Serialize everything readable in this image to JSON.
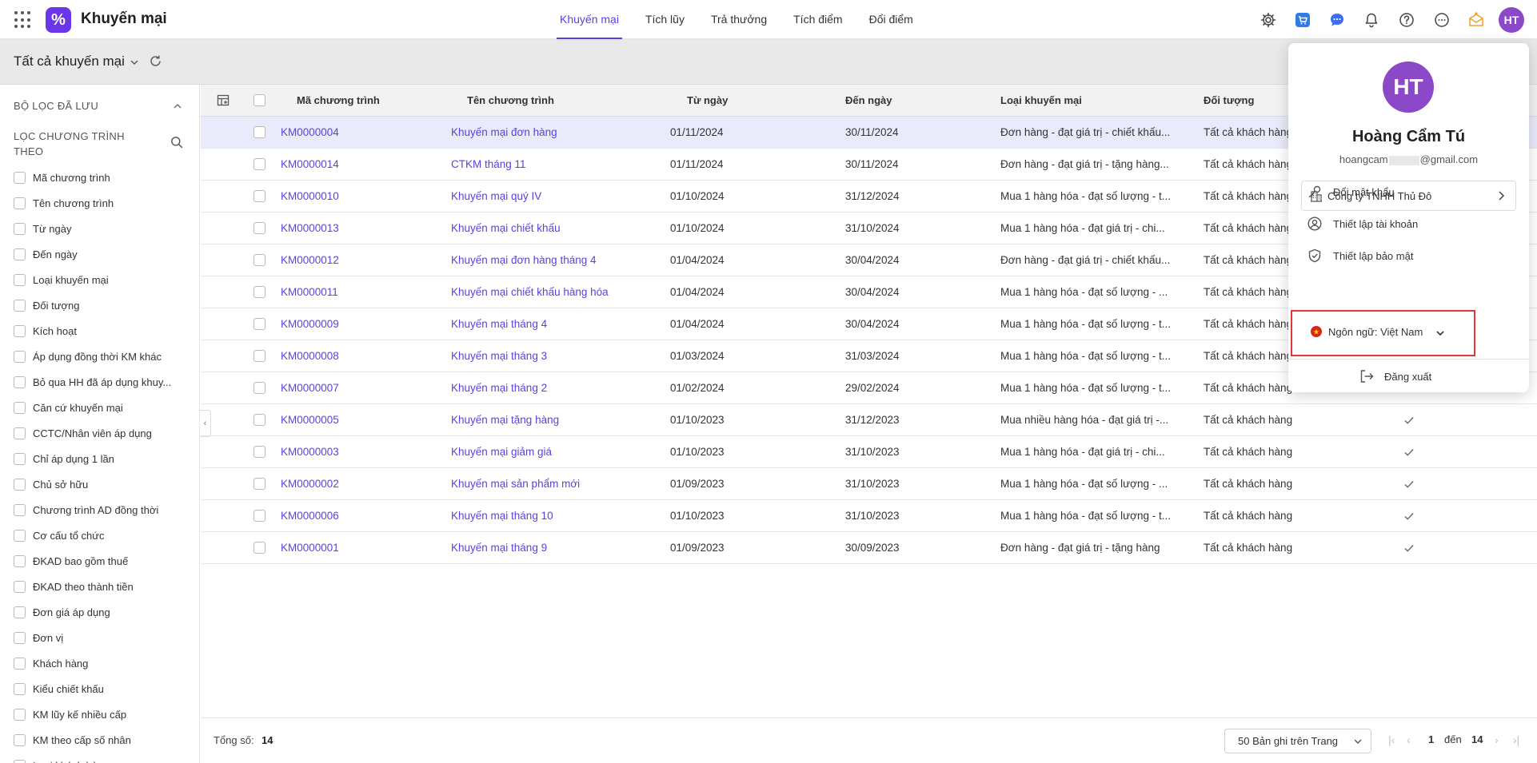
{
  "app": {
    "title": "Khuyến mại",
    "logo_glyph": "%"
  },
  "nav": {
    "items": [
      {
        "label": "Khuyến mại",
        "active": true
      },
      {
        "label": "Tích lũy",
        "active": false
      },
      {
        "label": "Trả thưởng",
        "active": false
      },
      {
        "label": "Tích điểm",
        "active": false
      },
      {
        "label": "Đổi điểm",
        "active": false
      }
    ]
  },
  "topbar": {
    "avatar_initials": "HT"
  },
  "subheader": {
    "view_label": "Tất cả khuyến mại"
  },
  "sidebar": {
    "saved_filters_label": "BỘ LỌC ĐÃ LƯU",
    "filter_by_label": "LỌC CHƯƠNG TRÌNH THEO",
    "filters": [
      "Mã chương trình",
      "Tên chương trình",
      "Từ ngày",
      "Đến ngày",
      "Loại khuyến mại",
      "Đối tượng",
      "Kích hoạt",
      "Áp dụng đồng thời KM khác",
      "Bỏ qua HH đã áp dụng khuy...",
      "Căn cứ khuyến mại",
      "CCTC/Nhân viên áp dụng",
      "Chỉ áp dụng 1 lần",
      "Chủ sở hữu",
      "Chương trình AD đồng thời",
      "Cơ cấu tổ chức",
      "ĐKAD bao gồm thuế",
      "ĐKAD theo thành tiền",
      "Đơn giá áp dụng",
      "Đơn vị",
      "Khách hàng",
      "Kiểu chiết khấu",
      "KM lũy kế nhiều cấp",
      "KM theo cấp số nhân",
      "Loại khách hàng"
    ]
  },
  "table": {
    "columns": {
      "code": "Mã chương trình",
      "name": "Tên chương trình",
      "from": "Từ ngày",
      "to": "Đến ngày",
      "type": "Loại khuyến mại",
      "target": "Đối tượng"
    },
    "rows": [
      {
        "code": "KM0000004",
        "name": "Khuyến mại đơn hàng",
        "from": "01/11/2024",
        "to": "30/11/2024",
        "type": "Đơn hàng - đạt giá trị - chiết khấu...",
        "target": "Tất cả khách hàng",
        "active": false,
        "selected": true
      },
      {
        "code": "KM0000014",
        "name": "CTKM tháng 11",
        "from": "01/11/2024",
        "to": "30/11/2024",
        "type": "Đơn hàng - đạt giá trị - tặng hàng...",
        "target": "Tất cả khách hàng",
        "active": false,
        "selected": false
      },
      {
        "code": "KM0000010",
        "name": "Khuyến mại quý IV",
        "from": "01/10/2024",
        "to": "31/12/2024",
        "type": "Mua 1 hàng hóa - đạt số lượng - t...",
        "target": "Tất cả khách hàng",
        "active": false,
        "selected": false
      },
      {
        "code": "KM0000013",
        "name": "Khuyến mại chiết khấu",
        "from": "01/10/2024",
        "to": "31/10/2024",
        "type": "Mua 1 hàng hóa - đạt giá trị - chi...",
        "target": "Tất cả khách hàng",
        "active": false,
        "selected": false
      },
      {
        "code": "KM0000012",
        "name": "Khuyến mại đơn hàng tháng 4",
        "from": "01/04/2024",
        "to": "30/04/2024",
        "type": "Đơn hàng - đạt giá trị - chiết khấu...",
        "target": "Tất cả khách hàng",
        "active": false,
        "selected": false
      },
      {
        "code": "KM0000011",
        "name": "Khuyến mại chiết khấu hàng hóa",
        "from": "01/04/2024",
        "to": "30/04/2024",
        "type": "Mua 1 hàng hóa - đạt số lượng - ...",
        "target": "Tất cả khách hàng",
        "active": false,
        "selected": false
      },
      {
        "code": "KM0000009",
        "name": "Khuyến mại tháng 4",
        "from": "01/04/2024",
        "to": "30/04/2024",
        "type": "Mua 1 hàng hóa - đạt số lượng - t...",
        "target": "Tất cả khách hàng",
        "active": false,
        "selected": false
      },
      {
        "code": "KM0000008",
        "name": "Khuyến mại tháng 3",
        "from": "01/03/2024",
        "to": "31/03/2024",
        "type": "Mua 1 hàng hóa - đạt số lượng - t...",
        "target": "Tất cả khách hàng",
        "active": false,
        "selected": false
      },
      {
        "code": "KM0000007",
        "name": "Khuyến mại tháng 2",
        "from": "01/02/2024",
        "to": "29/02/2024",
        "type": "Mua 1 hàng hóa - đạt số lượng - t...",
        "target": "Tất cả khách hàng",
        "active": false,
        "selected": false
      },
      {
        "code": "KM0000005",
        "name": "Khuyến mại tặng hàng",
        "from": "01/10/2023",
        "to": "31/12/2023",
        "type": "Mua nhiều hàng hóa - đạt giá trị -...",
        "target": "Tất cả khách hàng",
        "active": true,
        "selected": false
      },
      {
        "code": "KM0000003",
        "name": "Khuyến mại giảm giá",
        "from": "01/10/2023",
        "to": "31/10/2023",
        "type": "Mua 1 hàng hóa - đạt giá trị - chi...",
        "target": "Tất cả khách hàng",
        "active": true,
        "selected": false
      },
      {
        "code": "KM0000002",
        "name": "Khuyến mại sản phẩm mới",
        "from": "01/09/2023",
        "to": "31/10/2023",
        "type": "Mua 1 hàng hóa - đạt số lượng - ...",
        "target": "Tất cả khách hàng",
        "active": true,
        "selected": false
      },
      {
        "code": "KM0000006",
        "name": "Khuyến mại tháng 10",
        "from": "01/10/2023",
        "to": "31/10/2023",
        "type": "Mua 1 hàng hóa - đạt số lượng - t...",
        "target": "Tất cả khách hàng",
        "active": true,
        "selected": false
      },
      {
        "code": "KM0000001",
        "name": "Khuyến mại tháng 9",
        "from": "01/09/2023",
        "to": "30/09/2023",
        "type": "Đơn hàng - đạt giá trị - tặng hàng",
        "target": "Tất cả khách hàng",
        "active": true,
        "selected": false
      }
    ]
  },
  "footer": {
    "total_label": "Tổng số:",
    "total_value": "14",
    "per_page": "50 Bản ghi trên Trang",
    "current_page": "1",
    "to_label": "đến",
    "total_pages": "14"
  },
  "profile": {
    "initials": "HT",
    "name": "Hoàng Cẩm Tú",
    "email_prefix": "hoangcam",
    "email_suffix": "@gmail.com",
    "company": "Công ty TNHH Thủ Đô",
    "menu": {
      "change_password": "Đổi mật khẩu",
      "account_settings": "Thiết lập tài khoản",
      "security_settings": "Thiết lập bảo mật"
    },
    "language": "Ngôn ngữ: Việt Nam",
    "logout": "Đăng xuất"
  },
  "colors": {
    "accent": "#5b3fe4",
    "avatar": "#8b49c9",
    "highlight_box": "#e0373b",
    "selected_row": "#e9ebfa"
  }
}
